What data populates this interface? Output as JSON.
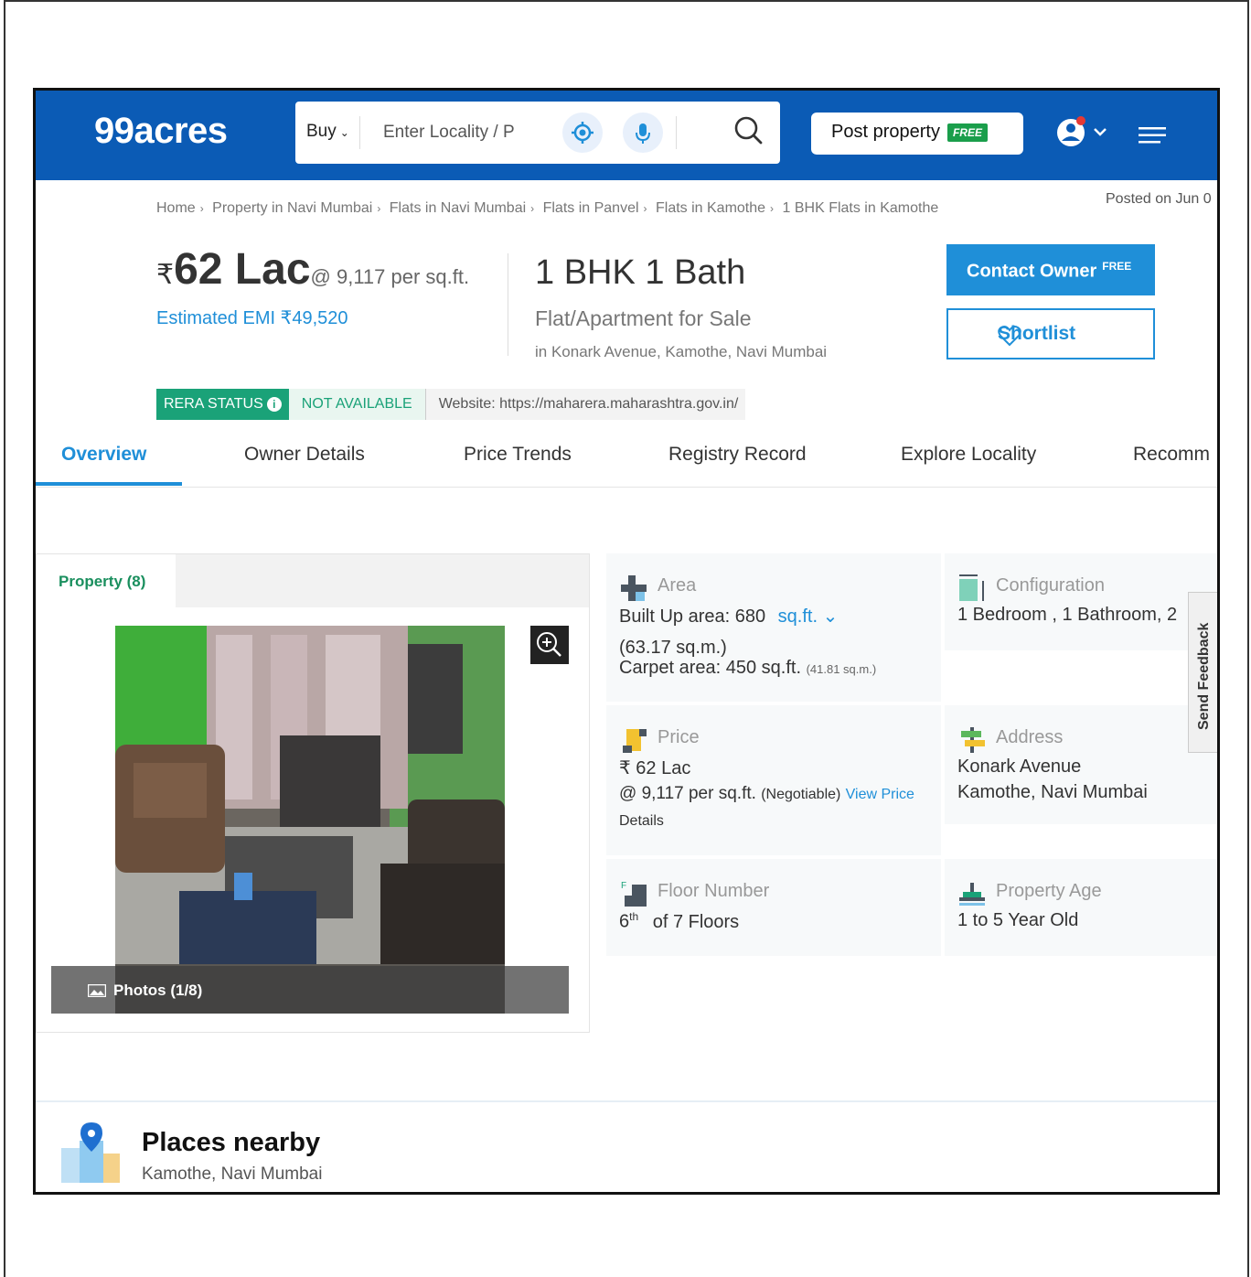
{
  "header": {
    "logo": "99acres",
    "buy_label": "Buy",
    "search_placeholder": "Enter Locality / P",
    "post_label": "Post property",
    "free_label": "FREE"
  },
  "breadcrumb": [
    "Home",
    "Property in Navi Mumbai",
    "Flats in Navi Mumbai",
    "Flats in Panvel",
    "Flats in Kamothe",
    "1 BHK Flats in Kamothe"
  ],
  "posted": "Posted on Jun 0",
  "price": {
    "rupee": "₹",
    "amount": "62 Lac",
    "per_sqft": "@ 9,117 per sq.ft.",
    "emi": "Estimated EMI ₹49,520"
  },
  "listing": {
    "title": "1 BHK 1 Bath",
    "type": "Flat/Apartment for Sale",
    "location": "in Konark Avenue, Kamothe, Navi Mumbai"
  },
  "actions": {
    "contact_label": "Contact Owner",
    "contact_free": "FREE",
    "shortlist_label": "Shortlist"
  },
  "rera": {
    "status_label": "RERA STATUS",
    "value": "NOT AVAILABLE",
    "website": "Website: https://maharera.maharashtra.gov.in/"
  },
  "tabs": [
    "Overview",
    "Owner Details",
    "Price Trends",
    "Registry Record",
    "Explore Locality",
    "Recomm"
  ],
  "gallery": {
    "tab_label": "Property (8)",
    "photos_label": "Photos (1/8)"
  },
  "details": {
    "area": {
      "caption": "Area",
      "built_up": "Built Up area: 680",
      "unit": "sq.ft.",
      "built_up_sqm": "(63.17 sq.m.)",
      "carpet": "Carpet area: 450 sq.ft.",
      "carpet_sqm": "(41.81 sq.m.)"
    },
    "configuration": {
      "caption": "Configuration",
      "value": "1 Bedroom , 1 Bathroom, 2"
    },
    "price": {
      "caption": "Price",
      "value": "₹ 62 Lac",
      "per_sqft": "@ 9,117 per sq.ft.",
      "negotiable": "(Negotiable)",
      "link_1": "View Price",
      "link_2": "Details"
    },
    "address": {
      "caption": "Address",
      "line1": "Konark Avenue",
      "line2": "Kamothe, Navi Mumbai"
    },
    "floor": {
      "caption": "Floor Number",
      "floor_num": "6",
      "floor_sup": "th",
      "of_floors": "of 7 Floors"
    },
    "age": {
      "caption": "Property Age",
      "value": "1 to 5 Year Old"
    }
  },
  "feedback_label": "Send Feedback",
  "places": {
    "title": "Places nearby",
    "subtitle": "Kamothe, Navi Mumbai"
  },
  "colors": {
    "brand_blue": "#0b5bb5",
    "accent_blue": "#1f8fd8",
    "rera_green": "#1aa278"
  }
}
